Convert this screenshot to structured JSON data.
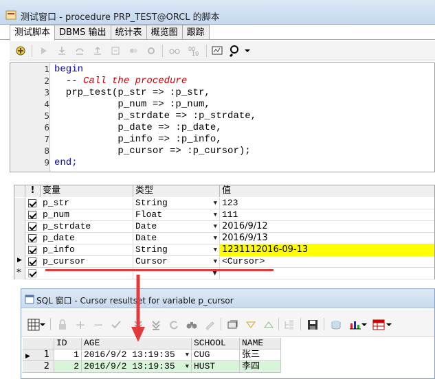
{
  "window": {
    "title": "测试窗口 - procedure PRP_TEST@ORCL 的脚本"
  },
  "tabs": [
    "测试脚本",
    "DBMS 输出",
    "统计表",
    "概览图",
    "跟踪"
  ],
  "code": {
    "line_numbers": [
      "1",
      "2",
      "3",
      "4",
      "5",
      "6",
      "7",
      "8",
      "9"
    ],
    "lines": [
      {
        "text": "begin",
        "style": "kw"
      },
      {
        "text": "  -- Call the procedure",
        "style": "cm"
      },
      {
        "text": "  prp_test(p_str => :p_str,",
        "style": ""
      },
      {
        "text": "           p_num => :p_num,",
        "style": ""
      },
      {
        "text": "           p_strdate => :p_strdate,",
        "style": ""
      },
      {
        "text": "           p_date => :p_date,",
        "style": ""
      },
      {
        "text": "           p_info => :p_info,",
        "style": ""
      },
      {
        "text": "           p_cursor => :p_cursor);",
        "style": ""
      },
      {
        "text": "end;",
        "style": "kw"
      }
    ]
  },
  "variables": {
    "headers": {
      "flag": "!",
      "name": "变量",
      "type": "类型",
      "value": "值"
    },
    "rows": [
      {
        "name": "p_str",
        "type": "String",
        "value": "123"
      },
      {
        "name": "p_num",
        "type": "Float",
        "value": "111"
      },
      {
        "name": "p_strdate",
        "type": "Date",
        "value": "2016/9/12"
      },
      {
        "name": "p_date",
        "type": "Date",
        "value": "2016/9/13"
      },
      {
        "name": "p_info",
        "type": "String",
        "value": "1231112016-09-13"
      },
      {
        "name": "p_cursor",
        "type": "Cursor",
        "value": "<Cursor>"
      }
    ],
    "new_row_marker": "*",
    "current_row_marker": "▶"
  },
  "sql_window": {
    "title": "SQL 窗口 - Cursor resultset for variable p_cursor",
    "columns": [
      "ID",
      "AGE",
      "SCHOOL",
      "NAME"
    ],
    "rows": [
      {
        "rownum": "1",
        "id": "1",
        "age": "2016/9/2 13:19:35",
        "school": "CUG",
        "name": "张三"
      },
      {
        "rownum": "2",
        "id": "2",
        "age": "2016/9/2 13:19:35",
        "school": "HUST",
        "name": "李四"
      }
    ]
  },
  "colors": {
    "highlight": "#ffff00",
    "annotation": "#e23b3b",
    "row_selected": "#d9f5d9"
  }
}
